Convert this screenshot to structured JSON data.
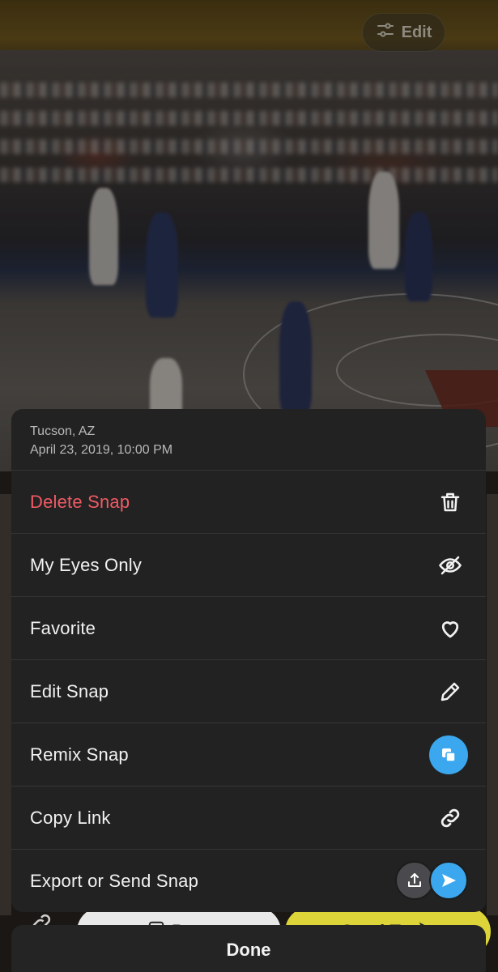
{
  "snap": {
    "edit_label": "Edit"
  },
  "behind": {
    "post_label": "Post",
    "send_label": "Send To"
  },
  "sheet": {
    "location": "Tucson, AZ",
    "timestamp": "April 23, 2019, 10:00 PM",
    "items": [
      {
        "label": "Delete Snap",
        "icon": "trash-icon",
        "color": "#f05a64"
      },
      {
        "label": "My Eyes Only",
        "icon": "eye-slash-icon"
      },
      {
        "label": "Favorite",
        "icon": "heart-icon"
      },
      {
        "label": "Edit Snap",
        "icon": "pencil-icon"
      },
      {
        "label": "Remix Snap",
        "icon": "remix-icon",
        "color": "#3aa7ee"
      },
      {
        "label": "Copy Link",
        "icon": "link-icon"
      },
      {
        "label": "Export or Send Snap",
        "icon": "export-send-icon",
        "color": "#3aa7ee"
      }
    ]
  },
  "done_label": "Done",
  "colors": {
    "sheet_bg": "#222222",
    "danger": "#f05a64",
    "accent_blue": "#3aa7ee",
    "send_yellow": "#ddd43a"
  }
}
